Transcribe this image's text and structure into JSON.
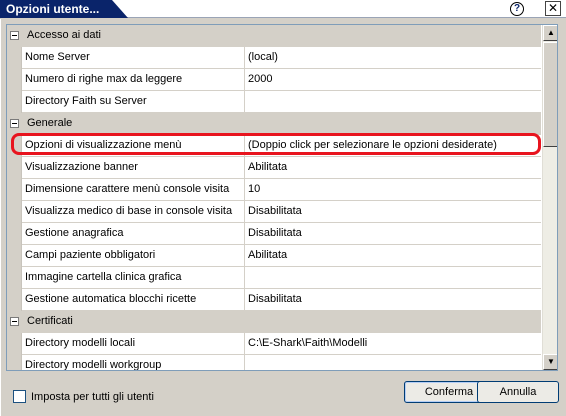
{
  "window": {
    "title": "Opzioni utente...",
    "help_symbol": "?",
    "close_symbol": "✕"
  },
  "grid": {
    "rows": [
      {
        "type": "category",
        "label": "Accesso ai dati"
      },
      {
        "type": "property",
        "name": "Nome Server",
        "value": "(local)"
      },
      {
        "type": "property",
        "name": "Numero di righe max da leggere",
        "value": "2000"
      },
      {
        "type": "property",
        "name": "Directory Faith su Server",
        "value": ""
      },
      {
        "type": "category",
        "label": "Generale"
      },
      {
        "type": "property",
        "name": "Opzioni di visualizzazione menù",
        "value": "(Doppio click per selezionare le opzioni desiderate)"
      },
      {
        "type": "property",
        "name": "Visualizzazione banner",
        "value": "Abilitata"
      },
      {
        "type": "property",
        "name": "Dimensione carattere menù console visita",
        "value": "10"
      },
      {
        "type": "property",
        "name": "Visualizza medico di base in console visita",
        "value": "Disabilitata"
      },
      {
        "type": "property",
        "name": "Gestione anagrafica",
        "value": "Disabilitata"
      },
      {
        "type": "property",
        "name": "Campi paziente obbligatori",
        "value": "Abilitata"
      },
      {
        "type": "property",
        "name": "Immagine cartella clinica grafica",
        "value": ""
      },
      {
        "type": "property",
        "name": "Gestione automatica blocchi ricette",
        "value": "Disabilitata"
      },
      {
        "type": "category",
        "label": "Certificati"
      },
      {
        "type": "property",
        "name": "Directory modelli locali",
        "value": "C:\\E-Shark\\Faith\\Modelli"
      },
      {
        "type": "property",
        "name": "Directory modelli workgroup",
        "value": ""
      }
    ],
    "scroll_up_symbol": "▲",
    "scroll_down_symbol": "▼"
  },
  "footer": {
    "apply_all_label": "Imposta per tutti gli utenti",
    "ok_label": "Conferma",
    "cancel_label": "Annulla"
  },
  "colors": {
    "title_bar": "#0a246a",
    "highlight": "#e8141e"
  }
}
